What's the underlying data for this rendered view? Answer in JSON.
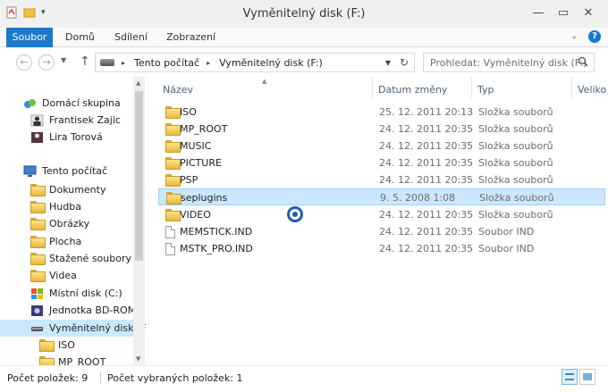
{
  "window": {
    "title": "Vyměnitelný disk (F:)"
  },
  "ribbon": {
    "tabs": [
      "Soubor",
      "Domů",
      "Sdílení",
      "Zobrazení"
    ]
  },
  "address": {
    "segments": [
      "Tento počítač",
      "Vyměnitelný disk (F:)"
    ],
    "search_placeholder": "Prohledat: Vyměnitelný disk (F:)"
  },
  "nav": {
    "items": [
      {
        "label": "Domácí skupina",
        "icon": "homegroup-icon"
      },
      {
        "label": "Frantisek Zajic",
        "icon": "user-icon"
      },
      {
        "label": "Lira Torová",
        "icon": "user-icon"
      },
      {
        "label": "Tento počítač",
        "icon": "computer-icon"
      },
      {
        "label": "Dokumenty",
        "icon": "folder-icon"
      },
      {
        "label": "Hudba",
        "icon": "folder-icon"
      },
      {
        "label": "Obrázky",
        "icon": "folder-icon"
      },
      {
        "label": "Plocha",
        "icon": "folder-icon"
      },
      {
        "label": "Stažené soubory",
        "icon": "folder-icon"
      },
      {
        "label": "Videa",
        "icon": "folder-icon"
      },
      {
        "label": "Místní disk (C:)",
        "icon": "drive-icon"
      },
      {
        "label": "Jednotka BD-ROM",
        "icon": "disc-icon"
      },
      {
        "label": "Vyměnitelný disk (F",
        "icon": "usb-drive-icon"
      },
      {
        "label": "ISO",
        "icon": "folder-icon"
      },
      {
        "label": "MP_ROOT",
        "icon": "folder-icon"
      }
    ]
  },
  "list": {
    "columns": [
      "Název",
      "Datum změny",
      "Typ",
      "Veliko"
    ],
    "rows": [
      {
        "name": "ISO",
        "date": "25. 12. 2011 20:13",
        "type": "Složka souborů",
        "kind": "folder"
      },
      {
        "name": "MP_ROOT",
        "date": "24. 12. 2011 20:35",
        "type": "Složka souborů",
        "kind": "folder"
      },
      {
        "name": "MUSIC",
        "date": "24. 12. 2011 20:35",
        "type": "Složka souborů",
        "kind": "folder"
      },
      {
        "name": "PICTURE",
        "date": "24. 12. 2011 20:35",
        "type": "Složka souborů",
        "kind": "folder"
      },
      {
        "name": "PSP",
        "date": "24. 12. 2011 20:35",
        "type": "Složka souborů",
        "kind": "folder"
      },
      {
        "name": "seplugins",
        "date": "9. 5. 2008 1:08",
        "type": "Složka souborů",
        "kind": "folder",
        "selected": true
      },
      {
        "name": "VIDEO",
        "date": "24. 12. 2011 20:35",
        "type": "Složka souborů",
        "kind": "folder"
      },
      {
        "name": "MEMSTICK.IND",
        "date": "24. 12. 2011 20:35",
        "type": "Soubor IND",
        "kind": "file"
      },
      {
        "name": "MSTK_PRO.IND",
        "date": "24. 12. 2011 20:35",
        "type": "Soubor IND",
        "kind": "file"
      }
    ]
  },
  "status": {
    "count": "Počet položek: 9",
    "selected": "Počet vybraných položek: 1"
  }
}
